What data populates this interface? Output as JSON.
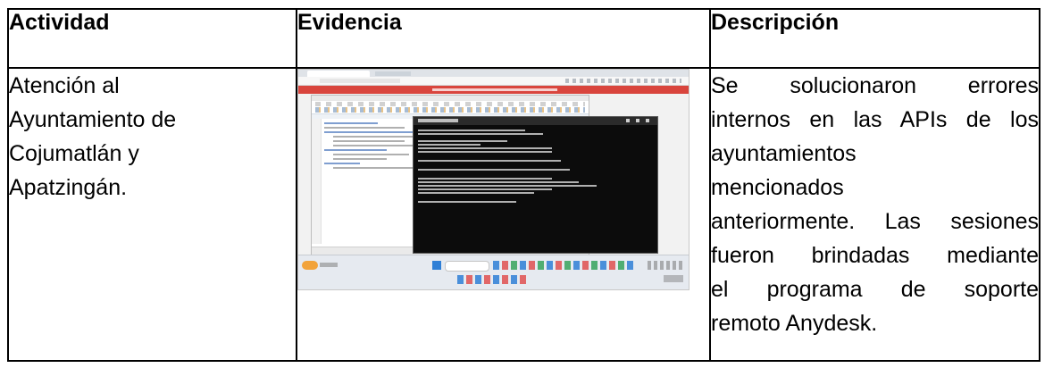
{
  "table": {
    "headers": [
      "Actividad",
      "Evidencia",
      "Descripción"
    ],
    "rows": [
      {
        "actividad_lines": [
          "Atención al",
          "Ayuntamiento de",
          "Cojumatlán y",
          "Apatzingán."
        ],
        "descripcion_lines": [
          "Se solucionaron errores",
          "internos en las APIs de los",
          "ayuntamientos",
          "mencionados",
          "anteriormente. Las sesiones",
          "fueron brindadas mediante",
          "el programa de soporte",
          "remoto Anydesk."
        ]
      }
    ]
  }
}
